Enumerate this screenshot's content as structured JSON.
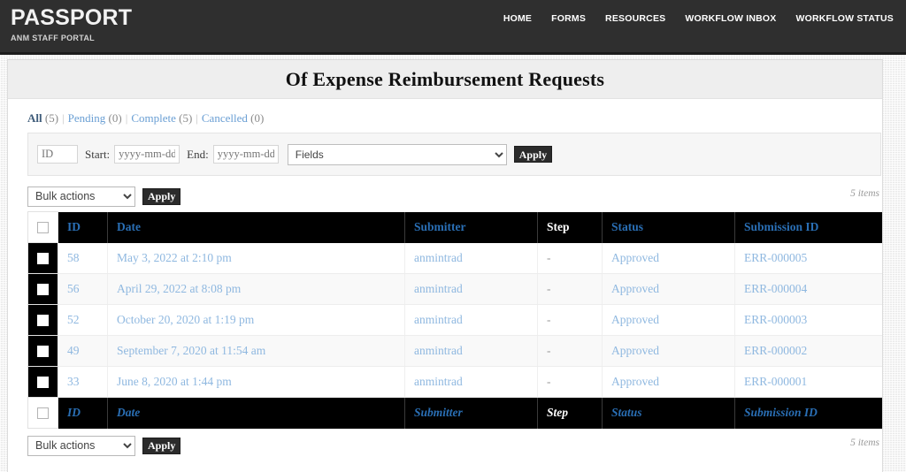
{
  "topbar": {
    "site_title": "PASSPORT",
    "site_tagline": "ANM STAFF PORTAL",
    "menu": [
      {
        "label": "HOME"
      },
      {
        "label": "FORMS"
      },
      {
        "label": "RESOURCES"
      },
      {
        "label": "WORKFLOW INBOX"
      },
      {
        "label": "WORKFLOW STATUS"
      }
    ]
  },
  "page": {
    "title": "Of Expense Reimbursement Requests"
  },
  "filters": {
    "links": [
      {
        "label": "All",
        "count": "(5)",
        "current": true
      },
      {
        "label": "Pending",
        "count": "(0)",
        "current": false
      },
      {
        "label": "Complete",
        "count": "(5)",
        "current": false
      },
      {
        "label": "Cancelled",
        "count": "(0)",
        "current": false
      }
    ],
    "separator": "|"
  },
  "search_form": {
    "id_placeholder": "ID",
    "id_value": "",
    "start_label": "Start:",
    "start_placeholder": "yyyy-mm-dd",
    "start_value": "",
    "end_label": "End:",
    "end_placeholder": "yyyy-mm-dd",
    "end_value": "",
    "fields_selected": "Fields",
    "fields_options": [
      "Fields"
    ],
    "apply_label": "Apply"
  },
  "tablenav_top": {
    "bulk_selected": "Bulk actions",
    "bulk_options": [
      "Bulk actions"
    ],
    "apply_label": "Apply",
    "items_count": "5 items"
  },
  "tablenav_bottom": {
    "bulk_selected": "Bulk actions",
    "bulk_options": [
      "Bulk actions"
    ],
    "apply_label": "Apply",
    "items_count": "5 items"
  },
  "table": {
    "columns": [
      {
        "key": "id",
        "label": "ID",
        "link": true
      },
      {
        "key": "date",
        "label": "Date",
        "link": true
      },
      {
        "key": "sub",
        "label": "Submitter",
        "link": true
      },
      {
        "key": "step",
        "label": "Step",
        "link": false
      },
      {
        "key": "status",
        "label": "Status",
        "link": true
      },
      {
        "key": "sid",
        "label": "Submission ID",
        "link": true
      }
    ],
    "rows": [
      {
        "id": "58",
        "date": "May 3, 2022 at 2:10 pm",
        "sub": "anmintrad",
        "step": "-",
        "status": "Approved",
        "sid": "ERR-000005"
      },
      {
        "id": "56",
        "date": "April 29, 2022 at 8:08 pm",
        "sub": "anmintrad",
        "step": "-",
        "status": "Approved",
        "sid": "ERR-000004"
      },
      {
        "id": "52",
        "date": "October 20, 2020 at 1:19 pm",
        "sub": "anmintrad",
        "step": "-",
        "status": "Approved",
        "sid": "ERR-000003"
      },
      {
        "id": "49",
        "date": "September 7, 2020 at 11:54 am",
        "sub": "anmintrad",
        "step": "-",
        "status": "Approved",
        "sid": "ERR-000002"
      },
      {
        "id": "33",
        "date": "June 8, 2020 at 1:44 pm",
        "sub": "anmintrad",
        "step": "-",
        "status": "Approved",
        "sid": "ERR-000001"
      }
    ]
  },
  "colors": {
    "topbar_bg": "#2f2f2f",
    "header_row_bg": "#000000",
    "link_blue": "#8fb8e0",
    "header_link_blue": "#2a6fb5",
    "apply_btn_bg": "#2b2b2b"
  }
}
